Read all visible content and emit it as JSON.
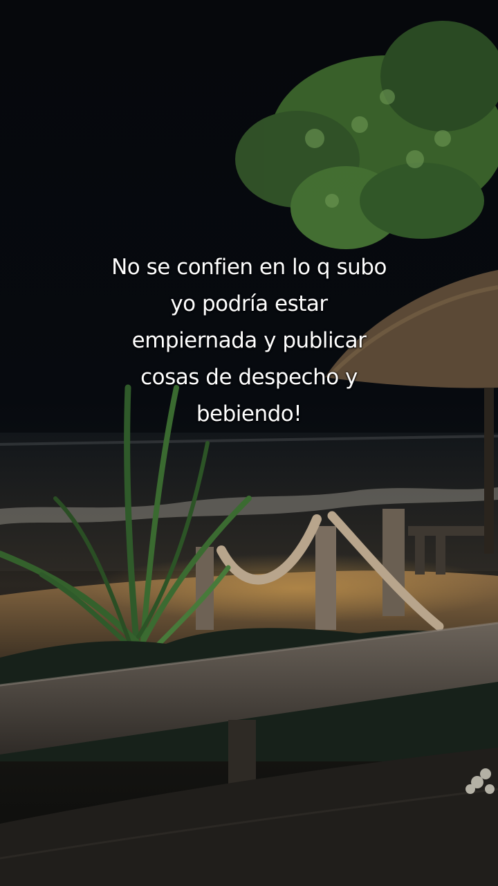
{
  "caption": {
    "lines": [
      "No se confien en lo q subo",
      "yo podría estar",
      "empiernada y publicar",
      "cosas de despecho y",
      "bebiendo!"
    ]
  },
  "colors": {
    "night_sky": "#06080c",
    "foliage": "#3f6a2e",
    "sand": "#c8a06a",
    "rail_wood": "#5a534a",
    "caption_text": "#ffffff"
  }
}
